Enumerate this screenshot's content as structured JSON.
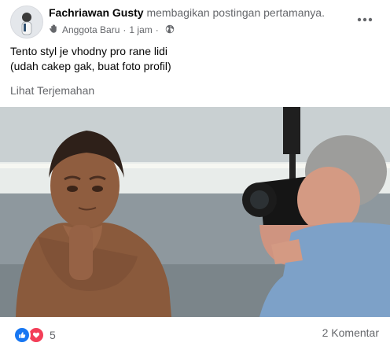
{
  "post": {
    "author": "Fachriawan Gusty",
    "action": "membagikan postingan pertamanya.",
    "badge": "Anggota Baru",
    "separator": "·",
    "time": "1 jam",
    "text_line_1": "Tento styl je vhodny pro rane lidi",
    "text_line_2": "(udah cakep gak, buat foto profil)",
    "translate_link": "Lihat Terjemahan"
  },
  "footer": {
    "reaction_count": "5",
    "comment_count": "2 Komentar"
  },
  "icons": {
    "badge": "new-member-hand-icon",
    "privacy": "globe-icon",
    "more": "more-horizontal-icon",
    "reaction_like": "like-reaction-icon",
    "reaction_love": "love-reaction-icon"
  },
  "colors": {
    "like": "#1877f2",
    "love": "#f33e58",
    "secondary_text": "#65676b"
  }
}
